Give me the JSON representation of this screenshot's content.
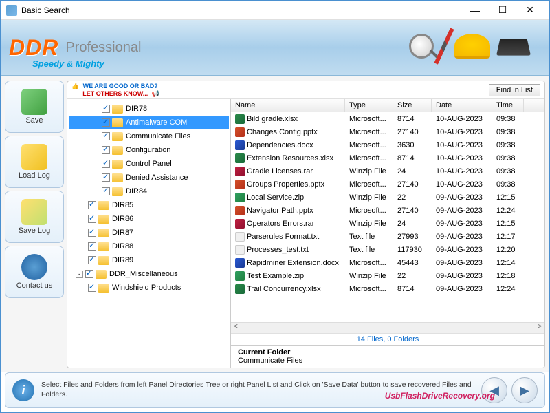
{
  "window": {
    "title": "Basic Search"
  },
  "banner": {
    "brand": "DDR",
    "product": "Professional",
    "tagline": "Speedy & Mighty"
  },
  "sidebar": {
    "save": "Save",
    "loadlog": "Load Log",
    "savelog": "Save Log",
    "contact": "Contact us"
  },
  "promo": {
    "line1": "WE ARE GOOD OR BAD?",
    "line2": "LET OTHERS KNOW..."
  },
  "findBtn": "Find in List",
  "tree": {
    "items": [
      {
        "indent": 48,
        "checked": true,
        "label": "DIR78"
      },
      {
        "indent": 48,
        "checked": true,
        "label": "Antimalware COM",
        "sel": true
      },
      {
        "indent": 48,
        "checked": true,
        "label": "Communicate Files"
      },
      {
        "indent": 48,
        "checked": true,
        "label": "Configuration"
      },
      {
        "indent": 48,
        "checked": true,
        "label": "Control Panel"
      },
      {
        "indent": 48,
        "checked": true,
        "label": "Denied Assistance"
      },
      {
        "indent": 48,
        "checked": true,
        "label": "DIR84"
      },
      {
        "indent": 28,
        "checked": true,
        "label": "DIR85"
      },
      {
        "indent": 28,
        "checked": true,
        "label": "DIR86"
      },
      {
        "indent": 28,
        "checked": true,
        "label": "DIR87"
      },
      {
        "indent": 28,
        "checked": true,
        "label": "DIR88"
      },
      {
        "indent": 28,
        "checked": true,
        "label": "DIR89"
      },
      {
        "indent": 10,
        "checked": true,
        "label": "DDR_Miscellaneous",
        "exp": "-"
      },
      {
        "indent": 28,
        "checked": true,
        "label": "Windshield Products"
      }
    ]
  },
  "columns": {
    "name": "Name",
    "type": "Type",
    "size": "Size",
    "date": "Date",
    "time": "Time"
  },
  "files": [
    {
      "icon": "xlsx",
      "name": "Bild gradle.xlsx",
      "type": "Microsoft...",
      "size": "8714",
      "date": "10-AUG-2023",
      "time": "09:38"
    },
    {
      "icon": "pptx",
      "name": "Changes Config.pptx",
      "type": "Microsoft...",
      "size": "27140",
      "date": "10-AUG-2023",
      "time": "09:38"
    },
    {
      "icon": "docx",
      "name": "Dependencies.docx",
      "type": "Microsoft...",
      "size": "3630",
      "date": "10-AUG-2023",
      "time": "09:38"
    },
    {
      "icon": "xlsx",
      "name": "Extension Resources.xlsx",
      "type": "Microsoft...",
      "size": "8714",
      "date": "10-AUG-2023",
      "time": "09:38"
    },
    {
      "icon": "rar",
      "name": "Gradle Licenses.rar",
      "type": "Winzip File",
      "size": "24",
      "date": "10-AUG-2023",
      "time": "09:38"
    },
    {
      "icon": "pptx",
      "name": "Groups Properties.pptx",
      "type": "Microsoft...",
      "size": "27140",
      "date": "10-AUG-2023",
      "time": "09:38"
    },
    {
      "icon": "zip",
      "name": "Local Service.zip",
      "type": "Winzip File",
      "size": "22",
      "date": "09-AUG-2023",
      "time": "12:15"
    },
    {
      "icon": "pptx",
      "name": "Navigator Path.pptx",
      "type": "Microsoft...",
      "size": "27140",
      "date": "09-AUG-2023",
      "time": "12:24"
    },
    {
      "icon": "rar",
      "name": "Operators Errors.rar",
      "type": "Winzip File",
      "size": "24",
      "date": "09-AUG-2023",
      "time": "12:15"
    },
    {
      "icon": "txt",
      "name": "Parserules Format.txt",
      "type": "Text file",
      "size": "27993",
      "date": "09-AUG-2023",
      "time": "12:17"
    },
    {
      "icon": "txt",
      "name": "Processes_test.txt",
      "type": "Text file",
      "size": "117930",
      "date": "09-AUG-2023",
      "time": "12:20"
    },
    {
      "icon": "docx",
      "name": "Rapidminer Extension.docx",
      "type": "Microsoft...",
      "size": "45443",
      "date": "09-AUG-2023",
      "time": "12:14"
    },
    {
      "icon": "zip",
      "name": "Test Example.zip",
      "type": "Winzip File",
      "size": "22",
      "date": "09-AUG-2023",
      "time": "12:18"
    },
    {
      "icon": "xlsx",
      "name": "Trail Concurrency.xlsx",
      "type": "Microsoft...",
      "size": "8714",
      "date": "09-AUG-2023",
      "time": "12:24"
    }
  ],
  "status": "14 Files, 0 Folders",
  "currentFolder": {
    "label": "Current Folder",
    "value": "Communicate Files"
  },
  "footer": {
    "text": "Select Files and Folders from left Panel Directories Tree or right Panel List and Click on 'Save Data' button to save recovered Files and Folders.",
    "watermark": "UsbFlashDriveRecovery.org"
  }
}
